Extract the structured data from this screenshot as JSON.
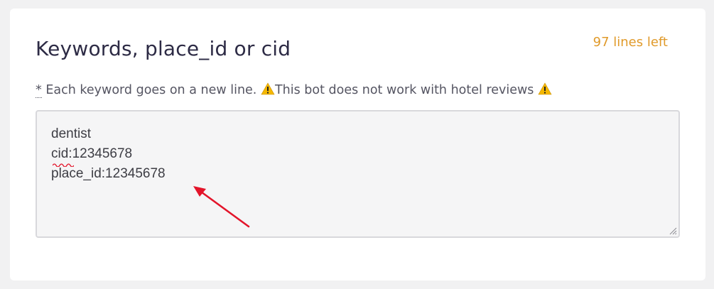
{
  "form": {
    "title": "Keywords, place_id or cid",
    "lines_left": "97 lines left",
    "hint_asterisk": "*",
    "hint_part1": " Each keyword goes on a new line. ",
    "hint_part2": "This bot does not work with hotel reviews ",
    "keywords_value": "dentist\ncid:12345678\nplace_id:12345678"
  },
  "colors": {
    "accent": "#e09a2a",
    "arrow": "#e3142a",
    "warning": "#f5b800"
  },
  "icons": {
    "warning": "warning-icon",
    "arrow": "arrow-annotation"
  }
}
